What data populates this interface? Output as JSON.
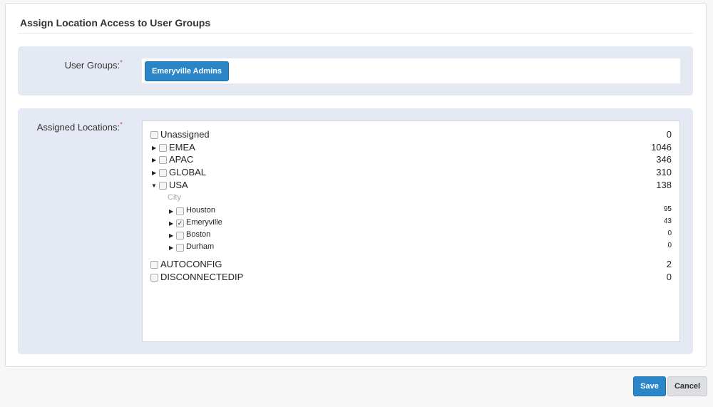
{
  "dialog": {
    "title": "Assign Location Access to User Groups"
  },
  "user_groups": {
    "label": "User Groups:",
    "required_mark": "*",
    "tags": [
      "Emeryville Admins"
    ]
  },
  "assigned_locations": {
    "label": "Assigned Locations:",
    "required_mark": "*",
    "sub_header": "City",
    "nodes": [
      {
        "label": "Unassigned",
        "count": "0",
        "checked": false
      },
      {
        "label": "EMEA",
        "count": "1046",
        "checked": false
      },
      {
        "label": "APAC",
        "count": "346",
        "checked": false
      },
      {
        "label": "GLOBAL",
        "count": "310",
        "checked": false
      },
      {
        "label": "USA",
        "count": "138",
        "checked": false
      },
      {
        "label": "AUTOCONFIG",
        "count": "2",
        "checked": false
      },
      {
        "label": "DISCONNECTEDIP",
        "count": "0",
        "checked": false
      }
    ],
    "usa_cities": [
      {
        "label": "Houston",
        "count": "95",
        "checked": false
      },
      {
        "label": "Emeryville",
        "count": "43",
        "checked": true
      },
      {
        "label": "Boston",
        "count": "0",
        "checked": false
      },
      {
        "label": "Durham",
        "count": "0",
        "checked": false
      }
    ]
  },
  "footer": {
    "save_label": "Save",
    "cancel_label": "Cancel"
  }
}
